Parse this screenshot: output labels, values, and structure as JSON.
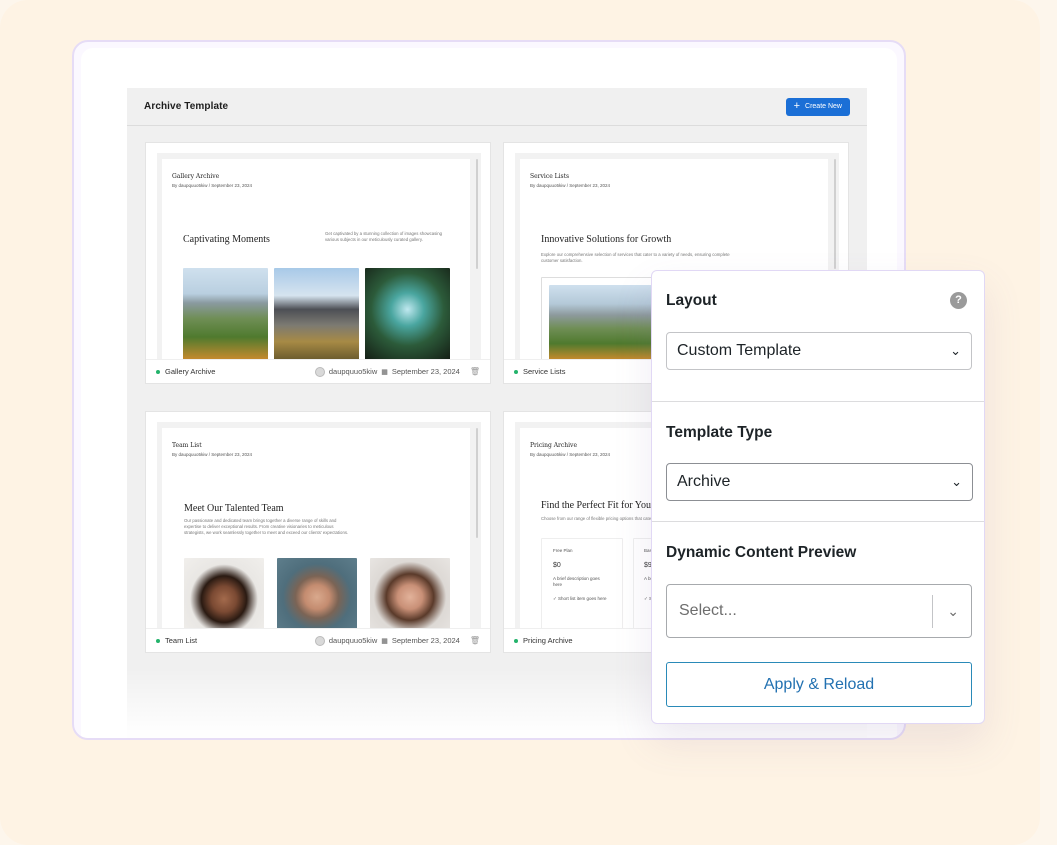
{
  "app": {
    "title": "Archive Template",
    "create_new_label": "Create New"
  },
  "cards": [
    {
      "doc_title": "Gallery Archive",
      "doc_meta": "By daupquuo5kiw / September 23, 2024",
      "heading": "Captivating Moments",
      "description": "Get captivated by a stunning collection of images showcasing various subjects in our meticulously curated gallery.",
      "footer_name": "Gallery Archive",
      "author": "daupquuo5kiw",
      "date": "September 23, 2024"
    },
    {
      "doc_title": "Service Lists",
      "doc_meta": "By daupquuo5kiw / September 23, 2024",
      "heading": "Innovative Solutions for Growth",
      "description": "Explore our comprehensive selection of services that cater to a variety of needs, ensuring complete customer satisfaction.",
      "footer_name": "Service Lists"
    },
    {
      "doc_title": "Team List",
      "doc_meta": "By daupquuo5kiw / September 23, 2024",
      "heading": "Meet Our Talented Team",
      "description": "Our passionate and dedicated team brings together a diverse range of skills and expertise to deliver exceptional results. From creative visionaries to meticulous strategists, we work seamlessly together to meet and exceed our clients' expectations.",
      "footer_name": "Team List",
      "author": "daupquuo5kiw",
      "date": "September 23, 2024"
    },
    {
      "doc_title": "Pricing Archive",
      "doc_meta": "By daupquuo5kiw / September 23, 2024",
      "heading": "Find the Perfect Fit for Your",
      "description": "Choose from our range of flexible pricing options that cater",
      "plan1_name": "Free Plan",
      "plan1_price": "$0",
      "plan1_desc": "A brief description goes here",
      "plan1_feature": "Short list item goes here",
      "plan2_name": "Basic",
      "plan2_price": "$9/",
      "plan2_desc": "A bri",
      "plan2_feature": "Sh",
      "footer_name": "Pricing Archive"
    }
  ],
  "panel": {
    "layout_label": "Layout",
    "layout_value": "Custom Template",
    "template_type_label": "Template Type",
    "template_type_value": "Archive",
    "dynamic_label": "Dynamic Content Preview",
    "dynamic_placeholder": "Select...",
    "apply_label": "Apply & Reload"
  },
  "icons": {
    "help": "question-circle-icon",
    "chevron": "chevron-down-icon",
    "plus": "plus-icon",
    "calendar": "calendar-icon",
    "trash": "trash-icon",
    "avatar": "user-avatar-icon"
  },
  "colors": {
    "accent": "#1b6fd6",
    "status_green": "#23b36b",
    "apply_border": "#2a8ab8"
  }
}
